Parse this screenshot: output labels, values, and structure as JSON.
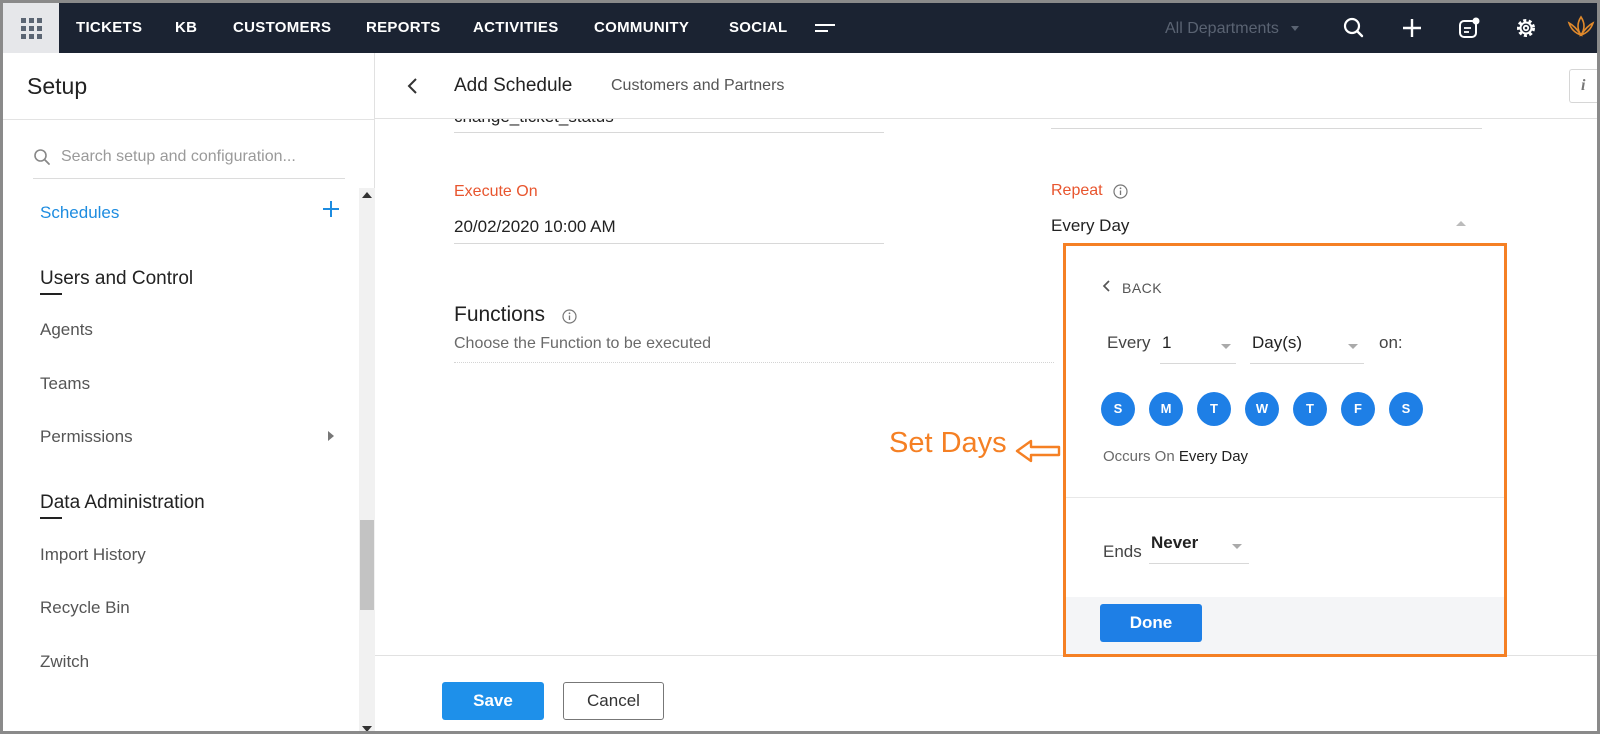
{
  "topnav": {
    "items": [
      "TICKETS",
      "KB",
      "CUSTOMERS",
      "REPORTS",
      "ACTIVITIES",
      "COMMUNITY",
      "SOCIAL"
    ],
    "department": "All Departments"
  },
  "sidebar": {
    "title": "Setup",
    "search_placeholder": "Search setup and configuration...",
    "active_item": "Schedules",
    "section_users": "Users and Control",
    "users_items": [
      "Agents",
      "Teams",
      "Permissions"
    ],
    "section_data": "Data Administration",
    "data_items": [
      "Import History",
      "Recycle Bin",
      "Zwitch"
    ]
  },
  "header": {
    "title": "Add Schedule",
    "subtitle": "Customers and Partners",
    "info_label": "i"
  },
  "form": {
    "partial_value": "change_ticket_status",
    "execute_on_label": "Execute On",
    "execute_on_value": "20/02/2020 10:00 AM",
    "repeat_label": "Repeat",
    "repeat_value": "Every Day",
    "functions_title": "Functions",
    "functions_subtitle": "Choose the Function to be executed"
  },
  "annotation": {
    "text": "Set Days",
    "color": "#f58024"
  },
  "repeat_popup": {
    "back_label": "BACK",
    "every_label": "Every",
    "interval_value": "1",
    "unit_value": "Day(s)",
    "on_label": "on:",
    "days": [
      "S",
      "M",
      "T",
      "W",
      "T",
      "F",
      "S"
    ],
    "occurs_prefix": "Occurs On",
    "occurs_value": "Every Day",
    "ends_label": "Ends",
    "ends_value": "Never",
    "done_label": "Done"
  },
  "actions": {
    "save_label": "Save",
    "cancel_label": "Cancel"
  },
  "colors": {
    "nav_bg": "#1b2332",
    "accent_blue": "#1e7fe6",
    "label_orange": "#e8552e",
    "highlight_orange": "#f58024"
  }
}
